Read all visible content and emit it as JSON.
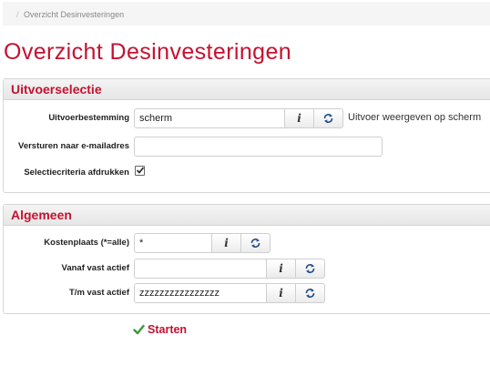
{
  "breadcrumb": {
    "separator": "/",
    "current": "Overzicht Desinvesteringen"
  },
  "page_title": "Overzicht Desinvesteringen",
  "uitvoerselectie": {
    "title": "Uitvoerselectie",
    "uitvoerbestemming": {
      "label": "Uitvoerbestemming",
      "value": "scherm",
      "description": "Uitvoer weergeven op scherm"
    },
    "email": {
      "label": "Versturen naar e-mailadres",
      "value": ""
    },
    "selectiecriteria": {
      "label": "Selectiecriteria afdrukken",
      "checked": true
    }
  },
  "algemeen": {
    "title": "Algemeen",
    "kostenplaats": {
      "label": "Kostenplaats (*=alle)",
      "value": "*"
    },
    "vanaf": {
      "label": "Vanaf vast actief",
      "value": ""
    },
    "tm": {
      "label": "T/m vast actief",
      "value": "zzzzzzzzzzzzzzzz"
    }
  },
  "actions": {
    "start_label": "Starten"
  },
  "colors": {
    "accent": "#c41230",
    "check": "#3a9a3a"
  }
}
